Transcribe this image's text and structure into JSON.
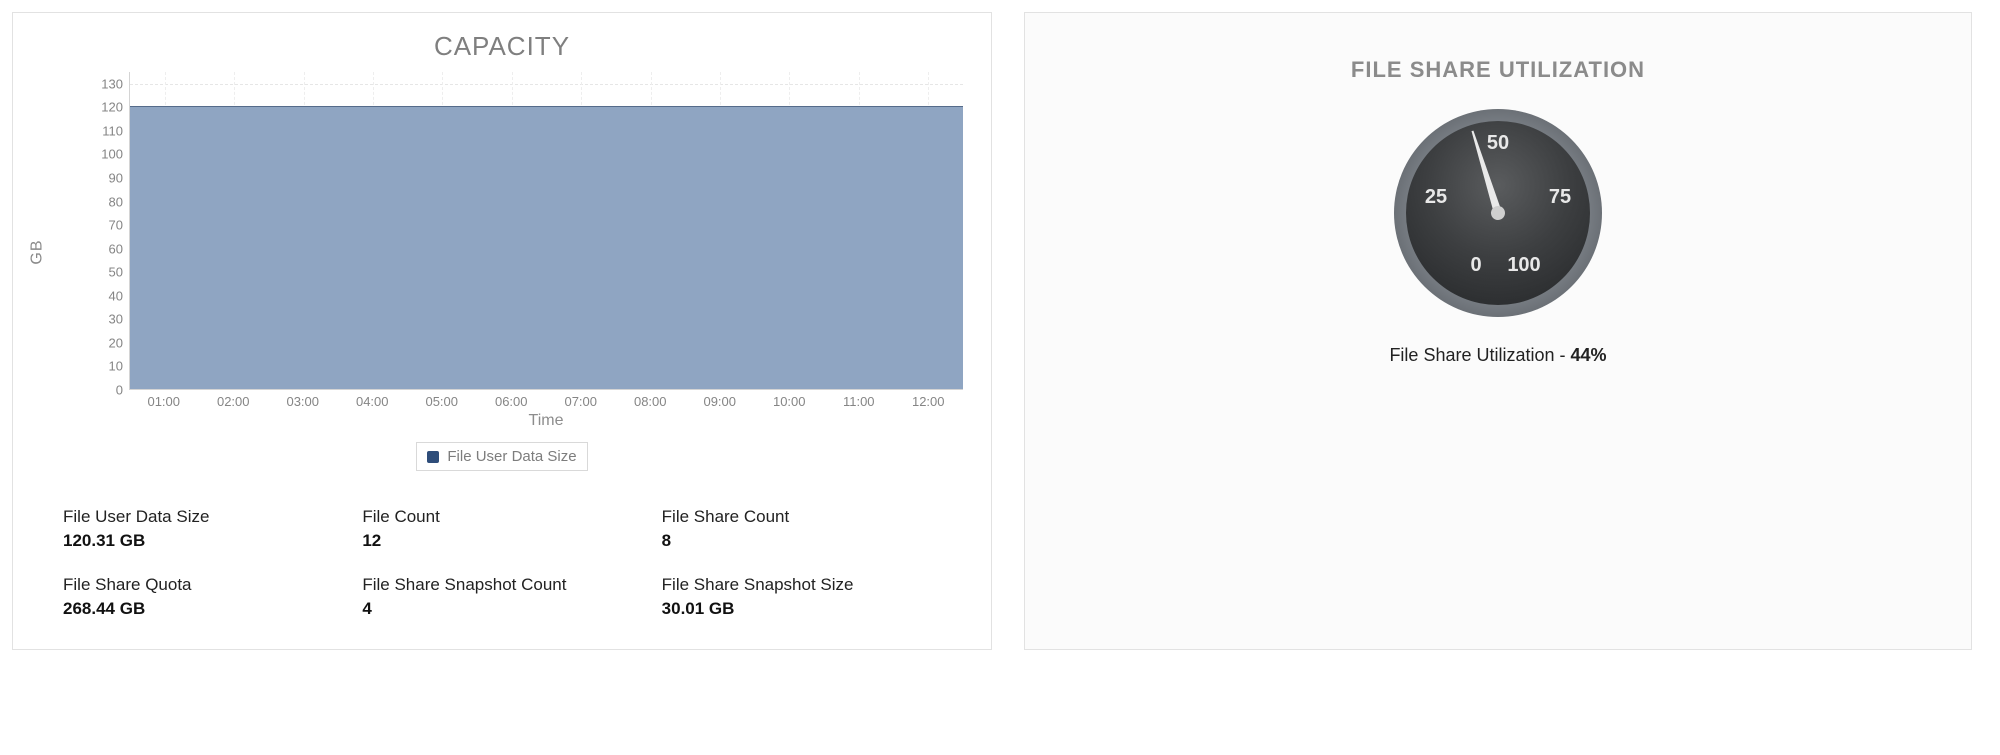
{
  "capacity": {
    "title": "CAPACITY",
    "ylabel": "GB",
    "xlabel": "Time",
    "legend": "File User Data Size"
  },
  "stats": {
    "file_user_data_size": {
      "label": "File User Data Size",
      "value": "120.31 GB"
    },
    "file_count": {
      "label": "File Count",
      "value": "12"
    },
    "file_share_count": {
      "label": "File Share Count",
      "value": "8"
    },
    "file_share_quota": {
      "label": "File Share Quota",
      "value": "268.44 GB"
    },
    "file_share_snapshot_count": {
      "label": "File Share Snapshot Count",
      "value": "4"
    },
    "file_share_snapshot_size": {
      "label": "File Share Snapshot Size",
      "value": "30.01 GB"
    }
  },
  "utilization": {
    "title": "FILE SHARE UTILIZATION",
    "caption_prefix": "File Share Utilization - ",
    "value_text": "44%",
    "gauge_ticks": {
      "t0": "0",
      "t25": "25",
      "t50": "50",
      "t75": "75",
      "t100": "100"
    }
  },
  "chart_data": [
    {
      "type": "area",
      "title": "CAPACITY",
      "xlabel": "Time",
      "ylabel": "GB",
      "ylim": [
        0,
        135
      ],
      "yticks": [
        0,
        10,
        20,
        30,
        40,
        50,
        60,
        70,
        80,
        90,
        100,
        110,
        120,
        130
      ],
      "x": [
        "01:00",
        "02:00",
        "03:00",
        "04:00",
        "05:00",
        "06:00",
        "07:00",
        "08:00",
        "09:00",
        "10:00",
        "11:00",
        "12:00"
      ],
      "series": [
        {
          "name": "File User Data Size",
          "values": [
            120.31,
            120.31,
            120.31,
            120.31,
            120.31,
            120.31,
            120.31,
            120.31,
            120.31,
            120.31,
            120.31,
            120.31
          ]
        }
      ],
      "legend_position": "bottom",
      "grid": true
    },
    {
      "type": "gauge",
      "title": "FILE SHARE UTILIZATION",
      "range": [
        0,
        100
      ],
      "ticks": [
        0,
        25,
        50,
        75,
        100
      ],
      "value": 44,
      "unit": "%",
      "annotation": "File Share Utilization - 44%"
    }
  ]
}
